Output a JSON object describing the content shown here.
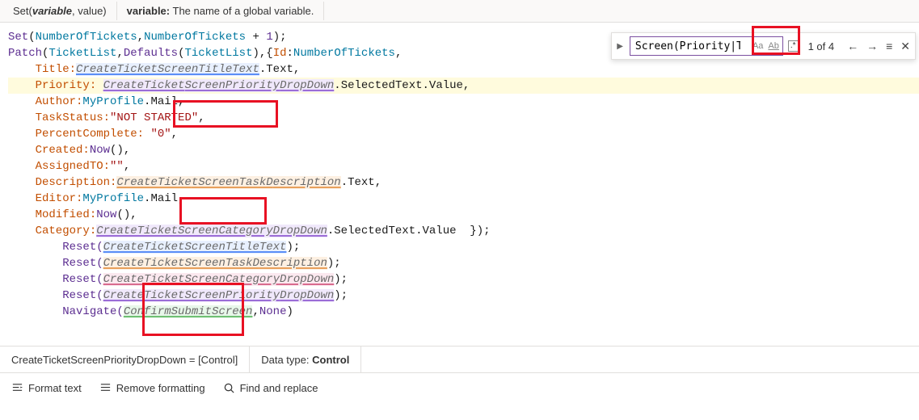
{
  "topbar": {
    "signature_prefix": "Set(",
    "signature_param1": "variable",
    "signature_rest": ", value)",
    "param_label": "variable:",
    "param_desc": " The name of a global variable."
  },
  "search": {
    "value": "Screen(Priority|Task)",
    "case_icon": "Aa",
    "word_icon": "Ab",
    "regex_icon": ".*",
    "count": "1 of 4",
    "prev": "←",
    "next": "→",
    "select_all": "≡",
    "close": "✕",
    "expand": "▶"
  },
  "code": {
    "l1_a": "Set",
    "l1_b": "(",
    "l1_c": "NumberOfTickets",
    "l1_d": ",",
    "l1_e": "NumberOfTickets",
    "l1_f": " + ",
    "l1_g": "1",
    "l1_h": ");",
    "l2_a": "Patch",
    "l2_b": "(",
    "l2_c": "TicketList",
    "l2_d": ",",
    "l2_e": "Defaults",
    "l2_f": "(",
    "l2_g": "TicketList",
    "l2_h": "),{",
    "l2_i": "Id",
    "l2_j": ":",
    "l2_k": "NumberOfTickets",
    "l2_l": ",",
    "l3_a": "    Title:",
    "l3_b": "CreateTicketScreenTitleText",
    "l3_c": ".Text,",
    "l4_a": "    Priority: ",
    "l4_b": "CreateTicket",
    "l4_c": "ScreenPriority",
    "l4_d": "DropDown",
    "l4_e": ".SelectedText.Value,",
    "l5_a": "    Author:",
    "l5_b": "MyProfile",
    "l5_c": ".Mail,",
    "l6_a": "    TaskStatus:",
    "l6_b": "\"NOT STARTED\"",
    "l6_c": ",",
    "l7_a": "    PercentComplete: ",
    "l7_b": "\"0\"",
    "l7_c": ",",
    "l8_a": "    Created:",
    "l8_b": "Now",
    "l8_c": "(),",
    "l9_a": "    AssignedTO:",
    "l9_b": "\"\"",
    "l9_c": ",",
    "l10_a": "    Description:",
    "l10_b": "CreateTicke",
    "l10_c": "tScreenTaskD",
    "l10_d": "escription",
    "l10_e": ".Text,",
    "l11_a": "    Editor:",
    "l11_b": "MyProfile",
    "l11_c": ".Mail,",
    "l12_a": "    Modified:",
    "l12_b": "Now",
    "l12_c": "(),",
    "l13_a": "    Category:",
    "l13_b": "CreateTicketScreenCategoryDropDown",
    "l13_c": ".SelectedText.Value  });",
    "l14_a": "    Reset(",
    "l14_b": "CreateTicketScreenTitleText",
    "l14_c": ");",
    "l15_a": "    Reset(",
    "l15_b": "CreateTicke",
    "l15_c": "tScreenTaskD",
    "l15_d": "escription",
    "l15_e": ");",
    "l16_a": "    Reset(",
    "l16_b": "CreateTicketScreenCategoryDropDown",
    "l16_c": ");",
    "l17_a": "    Reset(",
    "l17_b": "CreateTicke",
    "l17_c": "tScreenPriority",
    "l17_d": "DropDown",
    "l17_e": ");",
    "l18_a": "    Navigate(",
    "l18_b": "ConfirmSubmitScreen",
    "l18_c": ",",
    "l18_d": "None",
    "l18_e": ")"
  },
  "infobar": {
    "left": "CreateTicketScreenPriorityDropDown  =  [Control]",
    "right_label": "Data type: ",
    "right_value": "Control"
  },
  "bottombar": {
    "format": "Format text",
    "remove": "Remove formatting",
    "find": "Find and replace"
  }
}
